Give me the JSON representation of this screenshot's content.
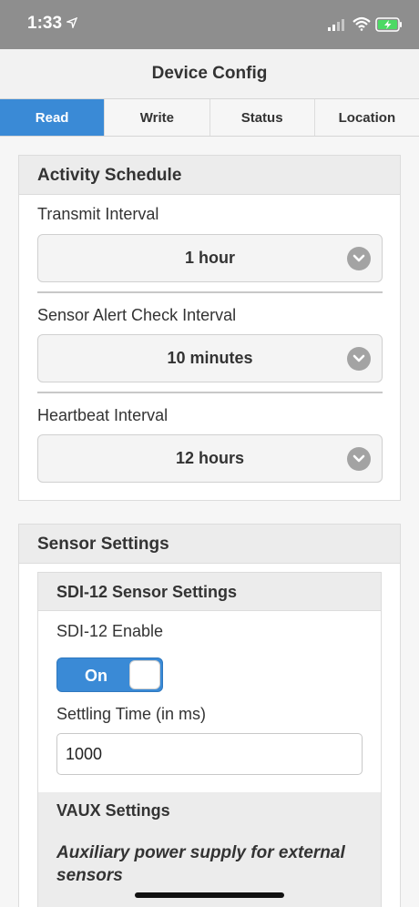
{
  "status_bar": {
    "time": "1:33"
  },
  "header": {
    "title": "Device Config"
  },
  "tabs": [
    {
      "label": "Read",
      "active": true
    },
    {
      "label": "Write"
    },
    {
      "label": "Status"
    },
    {
      "label": "Location"
    }
  ],
  "activity_schedule": {
    "title": "Activity Schedule",
    "fields": [
      {
        "label": "Transmit Interval",
        "value": "1 hour"
      },
      {
        "label": "Sensor Alert Check Interval",
        "value": "10 minutes"
      },
      {
        "label": "Heartbeat Interval",
        "value": "12 hours"
      }
    ]
  },
  "sensor_settings": {
    "title": "Sensor Settings",
    "sdi12": {
      "title": "SDI-12 Sensor Settings",
      "enable_label": "SDI-12 Enable",
      "toggle_state": "On",
      "settling_label": "Settling Time (in ms)",
      "settling_value": "1000"
    },
    "vaux": {
      "title": "VAUX Settings",
      "description": "Auxiliary power supply for external sensors"
    }
  },
  "colors": {
    "accent": "#3a8ad6",
    "status_bar": "#8e8e8e",
    "battery": "#4cd964"
  }
}
